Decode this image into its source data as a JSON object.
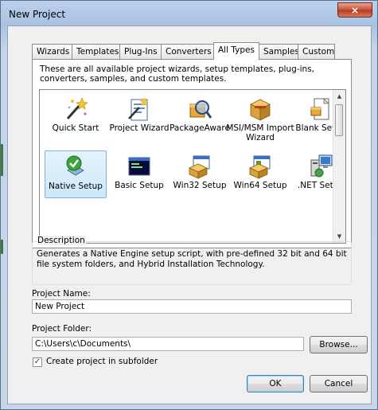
{
  "window": {
    "title": "New Project",
    "close_glyph": "×"
  },
  "tabs": [
    {
      "label": "Wizards"
    },
    {
      "label": "Templates"
    },
    {
      "label": "Plug-Ins"
    },
    {
      "label": "Converters"
    },
    {
      "label": "All Types",
      "active": true
    },
    {
      "label": "Samples"
    },
    {
      "label": "Custom"
    }
  ],
  "panel": {
    "description": "These are all available project wizards, setup templates, plug-ins, converters, samples, and custom templates.",
    "items": [
      {
        "label": "Quick Start",
        "icon": "magic-wand-icon"
      },
      {
        "label": "Project Wizard",
        "icon": "wizard-document-icon"
      },
      {
        "label": "PackageAware",
        "icon": "magnifier-package-icon"
      },
      {
        "label": "MSI/MSM Import Wizard",
        "icon": "box-import-icon"
      },
      {
        "label": "Blank Setup",
        "icon": "blank-setup-icon"
      },
      {
        "label": "Native Setup",
        "icon": "native-setup-icon",
        "selected": true
      },
      {
        "label": "Basic Setup",
        "icon": "console-window-icon"
      },
      {
        "label": "Win32 Setup",
        "icon": "win32-box-icon"
      },
      {
        "label": "Win64 Setup",
        "icon": "win64-box-icon"
      },
      {
        "label": ".NET Setup",
        "icon": "dotnet-computer-icon"
      }
    ],
    "scroll": {
      "up": "▲",
      "down": "▼"
    }
  },
  "description_group": {
    "title": "Description",
    "text": "Generates a Native Engine setup script, with pre-defined 32 bit and 64 bit file system folders, and Hybrid Installation Technology."
  },
  "form": {
    "project_name_label": "Project Name:",
    "project_name_value": "New Project",
    "project_folder_label": "Project Folder:",
    "project_folder_value": "C:\\Users\\c\\Documents\\",
    "browse_label": "Browse...",
    "subfolder_label": "Create project in subfolder",
    "subfolder_checked": true,
    "check_glyph": "✓"
  },
  "buttons": {
    "ok": "OK",
    "cancel": "Cancel"
  }
}
